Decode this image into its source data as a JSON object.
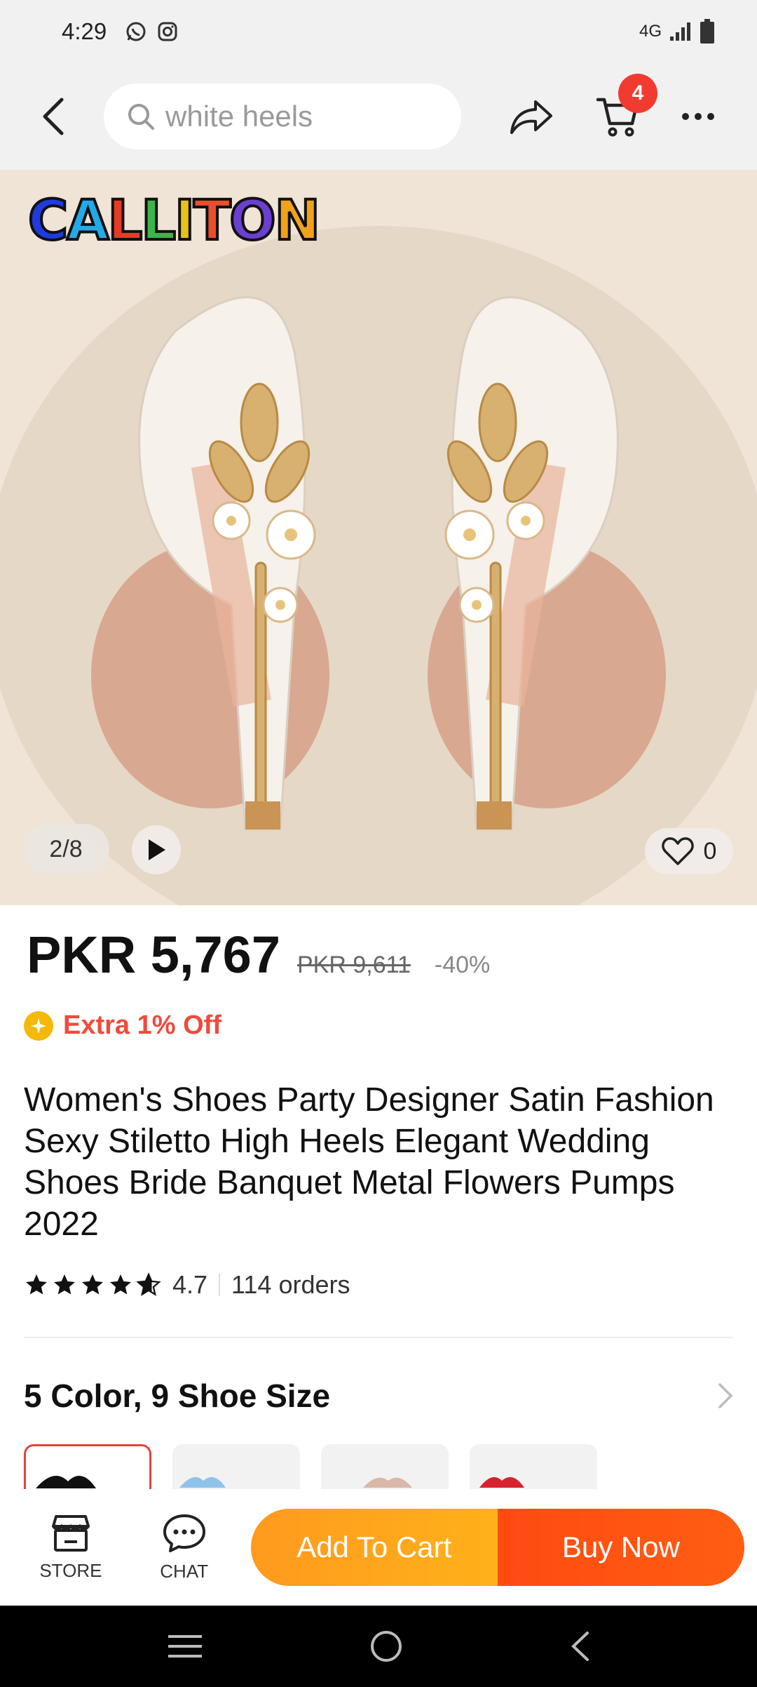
{
  "status_bar": {
    "time": "4:29",
    "network": "4G",
    "icons": [
      "whatsapp-icon",
      "instagram-icon",
      "signal-icon",
      "battery-icon"
    ]
  },
  "header": {
    "search_text": "white heels",
    "cart_count": "4"
  },
  "gallery": {
    "brand_logo": "CALLITON",
    "counter": "2/8",
    "likes": "0"
  },
  "product": {
    "price": "PKR 5,767",
    "original_price": "PKR 9,611",
    "discount": "-40%",
    "promo": "Extra 1% Off",
    "title": "Women's Shoes Party Designer Satin Fashion Sexy Stiletto High Heels Elegant Wedding Shoes Bride Banquet Metal Flowers Pumps 2022",
    "rating": "4.7",
    "orders": "114 orders",
    "variants_label": "5 Color, 9 Shoe Size",
    "swatch_colors": [
      "#111111",
      "#8fc3ea",
      "#d8b8a8",
      "#d8232f"
    ]
  },
  "bottom_bar": {
    "store_label": "STORE",
    "chat_label": "CHAT",
    "add_to_cart": "Add To Cart",
    "buy_now": "Buy Now"
  },
  "colors": {
    "accent_red": "#f23b30",
    "cta_orange": "#ffa51c",
    "cta_red": "#ff5212"
  }
}
